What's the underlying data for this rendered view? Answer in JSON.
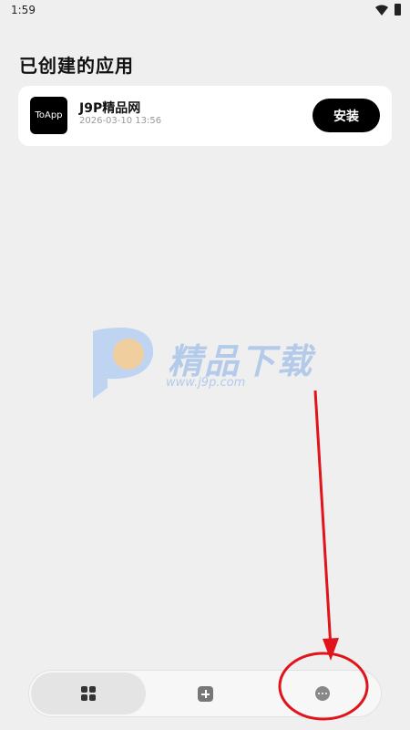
{
  "status_bar": {
    "time": "1:59"
  },
  "page": {
    "title": "已创建的应用"
  },
  "app_card": {
    "icon_label": "ToApp",
    "name": "J9P精品网",
    "created": "2026-03-10 13:56",
    "install_label": "安装"
  },
  "watermark": {
    "text": "精品下载",
    "url": "www.j9p.com"
  },
  "bottom_nav": {
    "items": [
      {
        "name": "apps",
        "icon": "apps-grid-icon",
        "selected": true
      },
      {
        "name": "add",
        "icon": "add-icon",
        "selected": false
      },
      {
        "name": "more",
        "icon": "more-icon",
        "selected": false
      }
    ]
  },
  "colors": {
    "background": "#efefef",
    "card": "#ffffff",
    "primary_button": "#000000",
    "annotation": "#e0141a",
    "watermark": "#a9c4ea"
  }
}
